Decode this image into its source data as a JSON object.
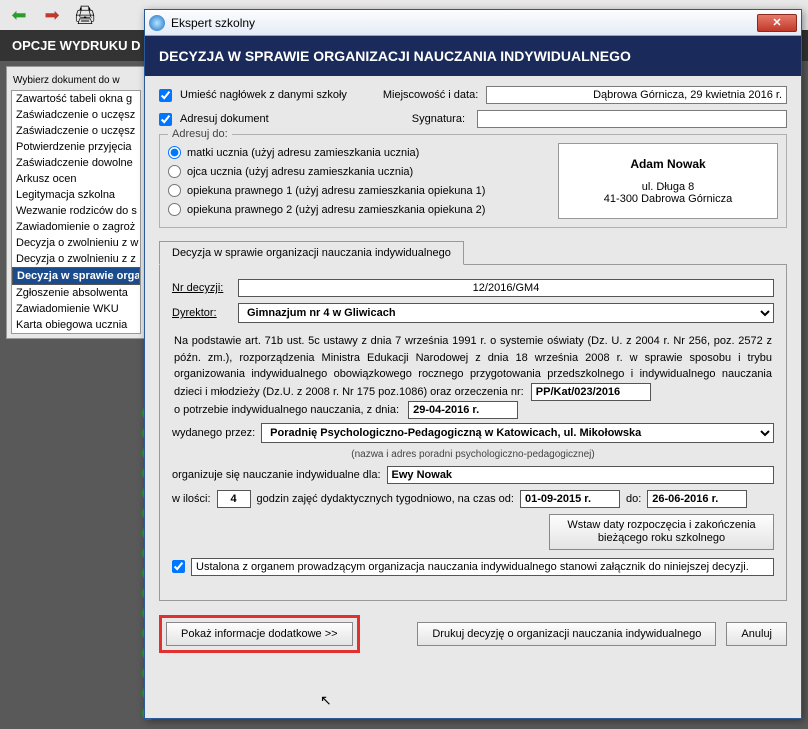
{
  "bg": {
    "header": "OPCJE WYDRUKU D",
    "panel_label": "Wybierz dokument do w",
    "items": [
      "Zawartość tabeli okna g",
      "Zaświadczenie o uczęsz",
      "Zaświadczenie o uczęsz",
      "Potwierdzenie przyjęcia",
      "Zaświadczenie dowolne",
      "Arkusz ocen",
      "Legitymacja szkolna",
      "Wezwanie rodziców do s",
      "Zawiadomienie o zagroż",
      "Decyzja o zwolnieniu z w",
      "Decyzja o zwolnieniu z z",
      "Decyzja w sprawie orgar",
      "Zgłoszenie absolwenta",
      "Zawiadomienie WKU",
      "Karta obiegowa ucznia"
    ],
    "selected_index": 11
  },
  "dialog": {
    "title": "Ekspert szkolny",
    "header": "DECYZJA W SPRAWIE ORGANIZACJI NAUCZANIA INDYWIDUALNEGO",
    "chk_header": "Umieść nagłówek z danymi szkoły",
    "chk_address": "Adresuj dokument",
    "loc_date_label": "Miejscowość i data:",
    "loc_date_value": "Dąbrowa Górnicza, 29 kwietnia 2016 r.",
    "sig_label": "Sygnatura:",
    "sig_value": "",
    "addr_legend": "Adresuj do:",
    "addr_opts": [
      "matki ucznia (użyj adresu zamieszkania ucznia)",
      "ojca ucznia (użyj adresu zamieszkania ucznia)",
      "opiekuna prawnego 1 (użyj adresu zamieszkania opiekuna 1)",
      "opiekuna prawnego 2 (użyj adresu zamieszkania opiekuna 2)"
    ],
    "addr_name": "Adam Nowak",
    "addr_street": "ul. Długa 8",
    "addr_city": "41-300 Dabrowa Górnicza",
    "tab_label": "Decyzja w sprawie organizacji nauczania indywidualnego",
    "nr_label": "Nr decyzji:",
    "nr_value": "12/2016/GM4",
    "dir_label": "Dyrektor:",
    "dir_value": "Gimnazjum nr 4 w Gliwicach",
    "para1": "Na podstawie art. 71b ust. 5c ustawy z dnia 7 września 1991 r. o systemie oświaty (Dz. U. z 2004 r. Nr 256, poz. 2572 z późn. zm.), rozporządzenia Ministra Edukacji Narodowej z dnia 18 września 2008 r. w sprawie sposobu i trybu organizowania indywidualnego obowiązkowego rocznego przygotowania przedszkolnego i indywidualnego nauczania dzieci i młodzieży (Dz.U. z 2008 r. Nr 175 poz.1086) oraz orzeczenia nr:",
    "orz_nr": "PP/Kat/023/2016",
    "para2": "o potrzebie indywidualnego nauczania, z dnia:",
    "orz_date": "29-04-2016 r.",
    "issued_label": "wydanego przez:",
    "issued_value": "Poradnię Psychologiczno-Pedagogiczną w Katowicach, ul. Mikołowska",
    "issued_note": "(nazwa i adres poradni psychologiczno-pedagogicznej)",
    "org_label": "organizuje się nauczanie indywidualne dla:",
    "org_value": "Ewy Nowak",
    "qty_label1": "w ilości:",
    "qty_value": "4",
    "qty_label2": "godzin zajęć dydaktycznych tygodniowo, na czas   od:",
    "date_from": "01-09-2015 r.",
    "date_to_label": "do:",
    "date_to": "26-06-2016 r.",
    "insert_btn": "Wstaw daty rozpoczęcia i zakończenia bieżącego roku szkolnego",
    "chk_attach": "Ustalona z organem prowadzącym organizacja nauczania indywidualnego stanowi załącznik do niniejszej decyzji.",
    "btn_more": "Pokaż informacje dodatkowe >>",
    "btn_print": "Drukuj decyzję o organizacji nauczania indywidualnego",
    "btn_cancel": "Anuluj"
  }
}
